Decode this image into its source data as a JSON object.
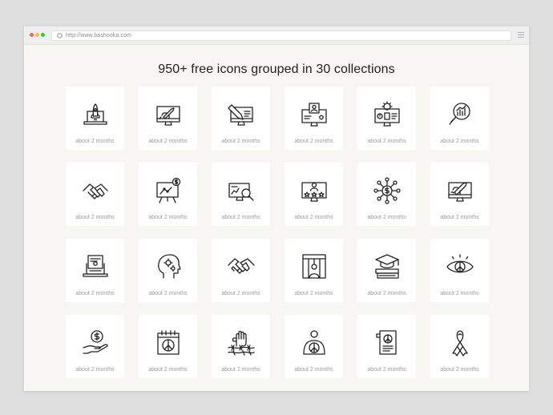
{
  "browser": {
    "url": "http://www.bashooka.com",
    "traffic_lights": [
      "#ff5f57",
      "#ffbd2e",
      "#28c840"
    ]
  },
  "page": {
    "headline": "950+ free icons grouped in 30 collections",
    "background": "#f8f6f3"
  },
  "cards": [
    {
      "icon": "laptop-rocket-icon",
      "caption": "about 2 months"
    },
    {
      "icon": "monitor-rocket-icon",
      "caption": "about 2 months"
    },
    {
      "icon": "monitor-design-tools-icon",
      "caption": "about 2 months"
    },
    {
      "icon": "monitor-profile-card-icon",
      "caption": "about 2 months"
    },
    {
      "icon": "monitor-dashboard-gear-icon",
      "caption": "about 2 months"
    },
    {
      "icon": "magnifier-chart-icon",
      "caption": "about 2 months"
    },
    {
      "icon": "handshake-icon",
      "caption": "about 2 months"
    },
    {
      "icon": "presentation-board-dollar-icon",
      "caption": "about 2 months"
    },
    {
      "icon": "monitor-search-chart-icon",
      "caption": "about 2 months"
    },
    {
      "icon": "monitor-user-rating-icon",
      "caption": "about 2 months"
    },
    {
      "icon": "dollar-network-icon",
      "caption": "about 2 months"
    },
    {
      "icon": "monitor-rocket-launch-icon",
      "caption": "about 2 months"
    },
    {
      "icon": "laptop-document-icon",
      "caption": "about 2 months"
    },
    {
      "icon": "head-gears-icon",
      "caption": "about 2 months"
    },
    {
      "icon": "handshake-deal-icon",
      "caption": "about 2 months"
    },
    {
      "icon": "prisoner-bars-icon",
      "caption": "about 2 months"
    },
    {
      "icon": "graduation-books-icon",
      "caption": "about 2 months"
    },
    {
      "icon": "eye-peace-icon",
      "caption": "about 2 months"
    },
    {
      "icon": "hand-coin-icon",
      "caption": "about 2 months"
    },
    {
      "icon": "calendar-peace-icon",
      "caption": "about 2 months"
    },
    {
      "icon": "fist-barbed-wire-icon",
      "caption": "about 2 months"
    },
    {
      "icon": "person-peace-icon",
      "caption": "about 2 months"
    },
    {
      "icon": "document-peace-icon",
      "caption": "about 2 months"
    },
    {
      "icon": "awareness-ribbon-icon",
      "caption": "about 2 months"
    }
  ]
}
